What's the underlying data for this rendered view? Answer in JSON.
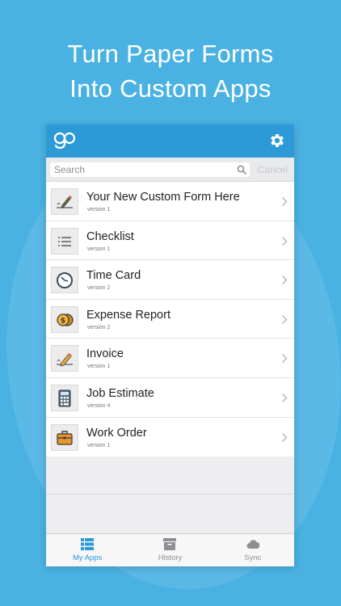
{
  "headline": {
    "line1": "Turn Paper Forms",
    "line2": "Into Custom Apps"
  },
  "navbar": {
    "logo_icon": "go-logo-icon",
    "settings_icon": "gear-icon"
  },
  "search": {
    "placeholder": "Search",
    "cancel_label": "Cancel"
  },
  "forms": [
    {
      "title": "Your New Custom Form Here",
      "version": "version 1",
      "icon": "pen-signature-icon"
    },
    {
      "title": "Checklist",
      "version": "version 1",
      "icon": "list-lines-icon"
    },
    {
      "title": "Time Card",
      "version": "version 2",
      "icon": "clock-icon"
    },
    {
      "title": "Expense Report",
      "version": "version 2",
      "icon": "coins-icon"
    },
    {
      "title": "Invoice",
      "version": "version 1",
      "icon": "pencil-icon"
    },
    {
      "title": "Job Estimate",
      "version": "version 4",
      "icon": "calculator-icon"
    },
    {
      "title": "Work Order",
      "version": "version 1",
      "icon": "briefcase-icon"
    }
  ],
  "tabs": [
    {
      "label": "My Apps",
      "icon": "apps-list-icon",
      "active": true
    },
    {
      "label": "History",
      "icon": "archive-box-icon",
      "active": false
    },
    {
      "label": "Sync",
      "icon": "cloud-icon",
      "active": false
    }
  ],
  "colors": {
    "background": "#4ab2e3",
    "navbar": "#2c9ad6",
    "active_tab": "#2c9ad6",
    "inactive_tab": "#8e8e93"
  }
}
